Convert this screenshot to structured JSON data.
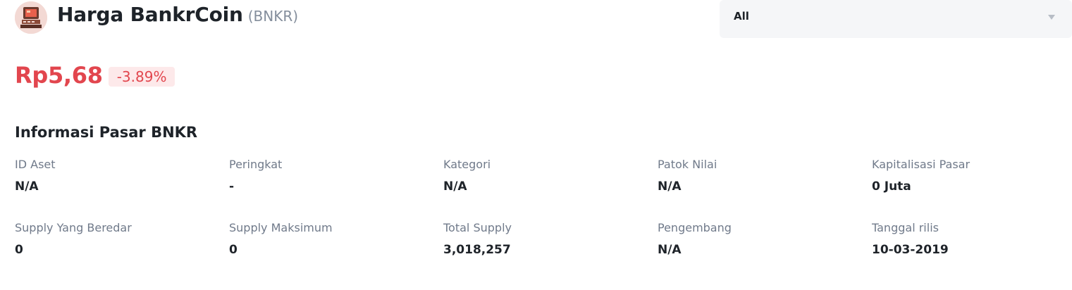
{
  "header": {
    "title": "Harga BankrCoin",
    "symbol": "(BNKR)",
    "avatar_icon": "bankrcoin-logo-icon"
  },
  "filter": {
    "selected": "All",
    "arrow_icon": "caret-down-icon"
  },
  "price": {
    "value": "Rp5,68",
    "change": "-3.89%",
    "color": "#e2464e",
    "badge_bg": "#fde9ea"
  },
  "market_info": {
    "title": "Informasi Pasar BNKR",
    "items": [
      {
        "label": "ID Aset",
        "value": "N/A"
      },
      {
        "label": "Peringkat",
        "value": "-"
      },
      {
        "label": "Kategori",
        "value": "N/A"
      },
      {
        "label": "Patok Nilai",
        "value": "N/A"
      },
      {
        "label": "Kapitalisasi Pasar",
        "value": "0 Juta"
      },
      {
        "label": "Supply Yang Beredar",
        "value": "0"
      },
      {
        "label": "Supply Maksimum",
        "value": "0"
      },
      {
        "label": "Total Supply",
        "value": "3,018,257"
      },
      {
        "label": "Pengembang",
        "value": "N/A"
      },
      {
        "label": "Tanggal rilis",
        "value": "10-03-2019"
      }
    ]
  }
}
